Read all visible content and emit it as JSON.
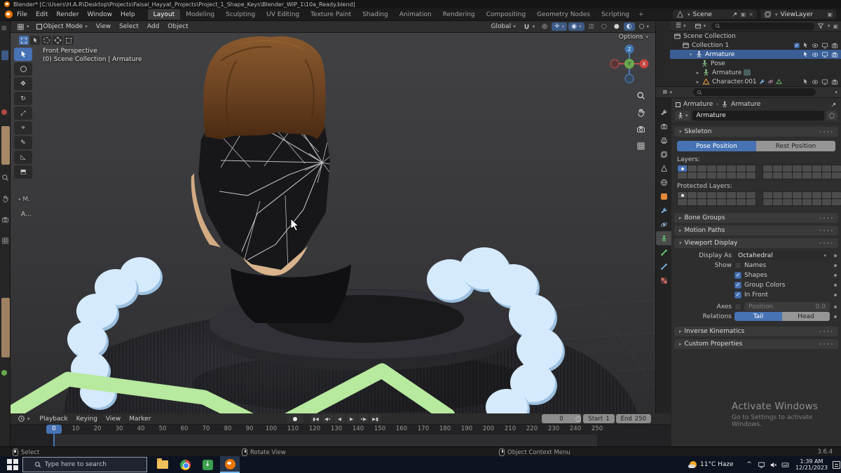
{
  "window": {
    "title": "Blender* [C:\\Users\\H.A.R\\Desktop\\Projects\\Faisal_Hayyat_Projects\\Project_1_Shape_Keys\\Blender_WIP_1\\10a_Ready.blend]"
  },
  "topbar": {
    "menus": [
      "File",
      "Edit",
      "Render",
      "Window",
      "Help"
    ],
    "workspaces": [
      {
        "label": "Layout",
        "active": true
      },
      "Modeling",
      "Sculpting",
      "UV Editing",
      "Texture Paint",
      "Shading",
      "Animation",
      "Rendering",
      "Compositing",
      "Geometry Nodes",
      "Scripting"
    ],
    "add_tab": "+",
    "scene_value": "Scene",
    "viewlayer_value": "ViewLayer"
  },
  "viewport": {
    "mode": "Object Mode",
    "menus": [
      "View",
      "Select",
      "Add",
      "Object"
    ],
    "orientation": "Global",
    "options_label": "Options",
    "view_label": "Front Perspective",
    "context_label": "(0) Scene Collection | Armature",
    "axes": {
      "x": "X",
      "y": "Y",
      "z": "Z"
    },
    "toolbar_collapsed": "M.",
    "annotation_badge": "A..."
  },
  "outliner": {
    "rows": [
      {
        "label": "Scene Collection"
      },
      {
        "label": "Collection 1"
      },
      {
        "label": "Armature"
      },
      {
        "label": "Pose"
      },
      {
        "label": "Armature"
      },
      {
        "label": "Character.001"
      }
    ]
  },
  "properties": {
    "breadcrumb_object": "Armature",
    "breadcrumb_data": "Armature",
    "name_value": "Armature",
    "skeleton": "Skeleton",
    "pose_position": "Pose Position",
    "rest_position": "Rest Position",
    "layers_label": "Layers:",
    "protected_label": "Protected Layers:",
    "bone_groups": "Bone Groups",
    "motion_paths": "Motion Paths",
    "viewport_display": "Viewport Display",
    "display_as_label": "Display As",
    "display_as_value": "Octahedral",
    "show_label": "Show",
    "names_label": "Names",
    "shapes_label": "Shapes",
    "group_colors_label": "Group Colors",
    "in_front_label": "In Front",
    "axes_label": "Axes",
    "position_label": "Position",
    "position_value": "0.0",
    "relations_label": "Relations",
    "tail_label": "Tail",
    "head_label": "Head",
    "inverse_kinematics": "Inverse Kinematics",
    "custom_properties": "Custom Properties"
  },
  "timeline": {
    "menus": [
      "Playback",
      "Keying",
      "View",
      "Marker"
    ],
    "current_frame": "0",
    "start_label": "Start",
    "start_value": "1",
    "end_label": "End",
    "end_value": "250",
    "tick_step": 10,
    "tick_max": 250
  },
  "statusbar": {
    "hints": [
      "Select",
      "Rotate View",
      "Object Context Menu"
    ],
    "version": "3.6.4"
  },
  "taskbar": {
    "search_placeholder": "Type here to search",
    "weather": "11°C Haze",
    "time": "1:39 AM",
    "date": "12/21/2023"
  },
  "watermark": {
    "line1": "Activate Windows",
    "line2": "Go to Settings to activate Windows."
  },
  "colors": {
    "accent": "#4772b3",
    "selection": "#3b5e97",
    "hair": "#6e4423",
    "skin": "#d9b48c",
    "pads": "#d5eafd",
    "band": "#b7e99e"
  }
}
